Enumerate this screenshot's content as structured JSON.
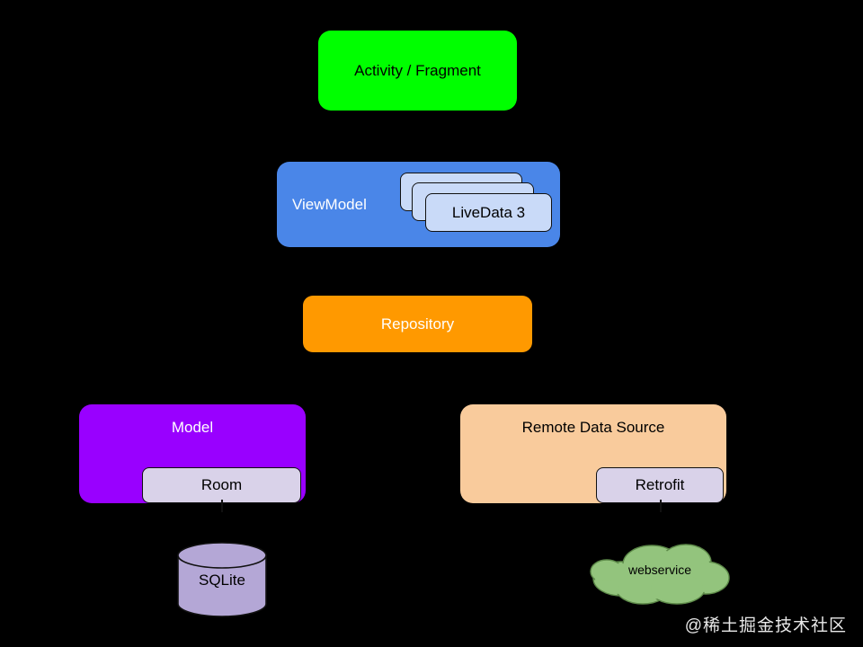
{
  "diagram": {
    "background_color": "#000000",
    "nodes": {
      "activity": {
        "label": "Activity / Fragment",
        "color": "#00ff00",
        "text_color": "#000000"
      },
      "viewmodel": {
        "label": "ViewModel",
        "color": "#4a86e8",
        "text_color": "#ffffff"
      },
      "livedata": {
        "label": "LiveData 3",
        "color": "#c9daf8",
        "stack_count": 3,
        "cards": [
          "",
          "",
          "LiveData 3"
        ]
      },
      "repository": {
        "label": "Repository",
        "color": "#ff9900",
        "text_color": "#ffffff"
      },
      "model": {
        "label": "Model",
        "color": "#9900ff",
        "text_color": "#ffffff"
      },
      "room": {
        "label": "Room",
        "color": "#d9d2e9",
        "text_color": "#000000"
      },
      "remote_data_source": {
        "label": "Remote Data Source",
        "color": "#f9cb9c",
        "text_color": "#000000"
      },
      "retrofit": {
        "label": "Retrofit",
        "color": "#d9d2e9",
        "text_color": "#000000"
      },
      "sqlite": {
        "label": "SQLite",
        "color": "#b4a7d6",
        "text_color": "#000000",
        "shape": "cylinder-icon"
      },
      "webservice": {
        "label": "webservice",
        "color": "#93c47d",
        "text_color": "#000000",
        "shape": "cloud-icon"
      }
    },
    "watermark": "@稀土掘金技术社区"
  }
}
